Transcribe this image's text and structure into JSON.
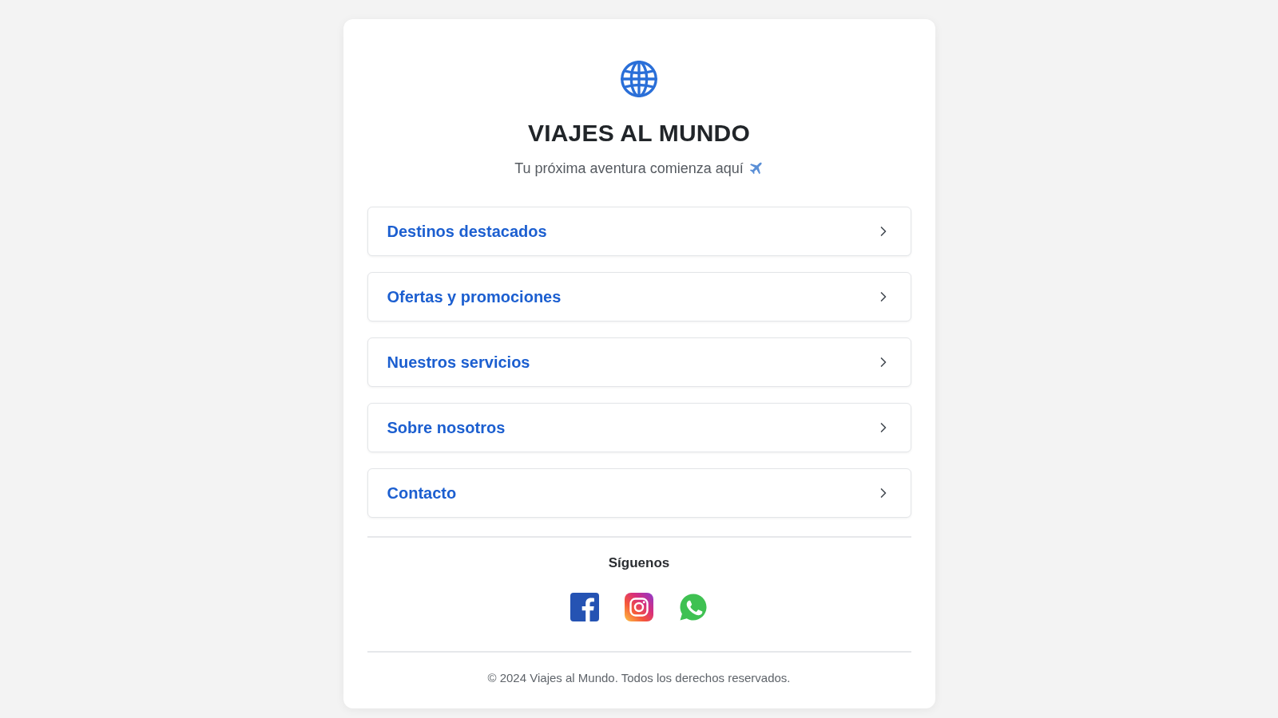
{
  "header": {
    "title": "VIAJES AL MUNDO",
    "subtitle": "Tu próxima aventura comienza aquí"
  },
  "menu": {
    "items": [
      {
        "label": "Destinos destacados"
      },
      {
        "label": "Ofertas y promociones"
      },
      {
        "label": "Nuestros servicios"
      },
      {
        "label": "Sobre nosotros"
      },
      {
        "label": "Contacto"
      }
    ]
  },
  "social": {
    "heading": "Síguenos"
  },
  "footer": {
    "text": "© 2024 Viajes al Mundo. Todos los derechos reservados."
  }
}
